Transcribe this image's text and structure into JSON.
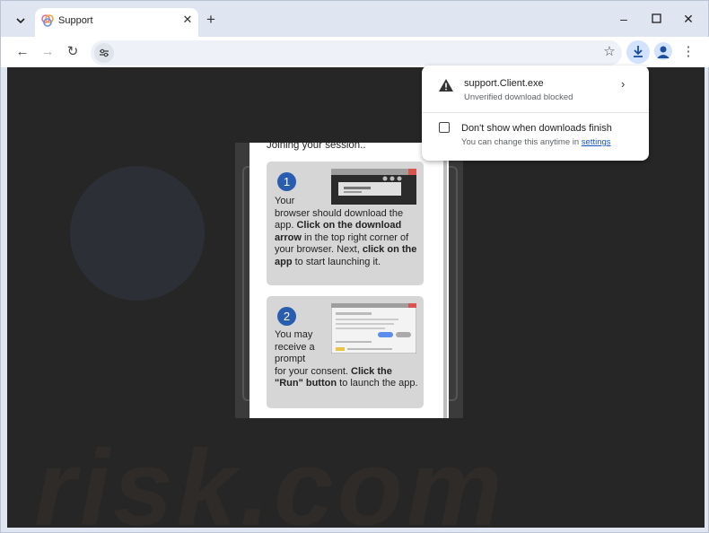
{
  "tab": {
    "title": "Support"
  },
  "toolbar": {
    "address": ""
  },
  "page": {
    "joining": "Joining your session..",
    "step1": {
      "number": "1",
      "t1": "Your",
      "t2": "browser should download the",
      "t3a": "app. ",
      "t3b": "Click on the download",
      "t4a": "arrow",
      "t4b": " in the top right corner of",
      "t5a": "your browser. Next, ",
      "t5b": "click on the",
      "t6a": "app",
      "t6b": " to start launching it."
    },
    "step2": {
      "number": "2",
      "t1": "You may",
      "t2": "receive a",
      "t3": "prompt",
      "t4a": "for your consent. ",
      "t4b": "Click the",
      "t5a": "\"Run\" button",
      "t5b": " to launch the app."
    },
    "watermark": "risk.com"
  },
  "download_bubble": {
    "file_name": "support.Client.exe",
    "status": "Unverified download blocked",
    "checkbox_label": "Don't show when downloads finish",
    "note_prefix": "You can change this anytime in ",
    "note_link": "settings"
  },
  "colors": {
    "accent": "#1a56c4",
    "step_badge": "#2a5db0",
    "download_active": "#d3e3fd"
  },
  "icons": [
    "tab-search-icon",
    "favicon-icon",
    "close-icon",
    "plus-icon",
    "minimize-icon",
    "maximize-icon",
    "back-icon",
    "forward-icon",
    "reload-icon",
    "site-info-icon",
    "star-icon",
    "download-icon",
    "profile-icon",
    "menu-icon",
    "warning-icon",
    "chevron-right-icon"
  ]
}
